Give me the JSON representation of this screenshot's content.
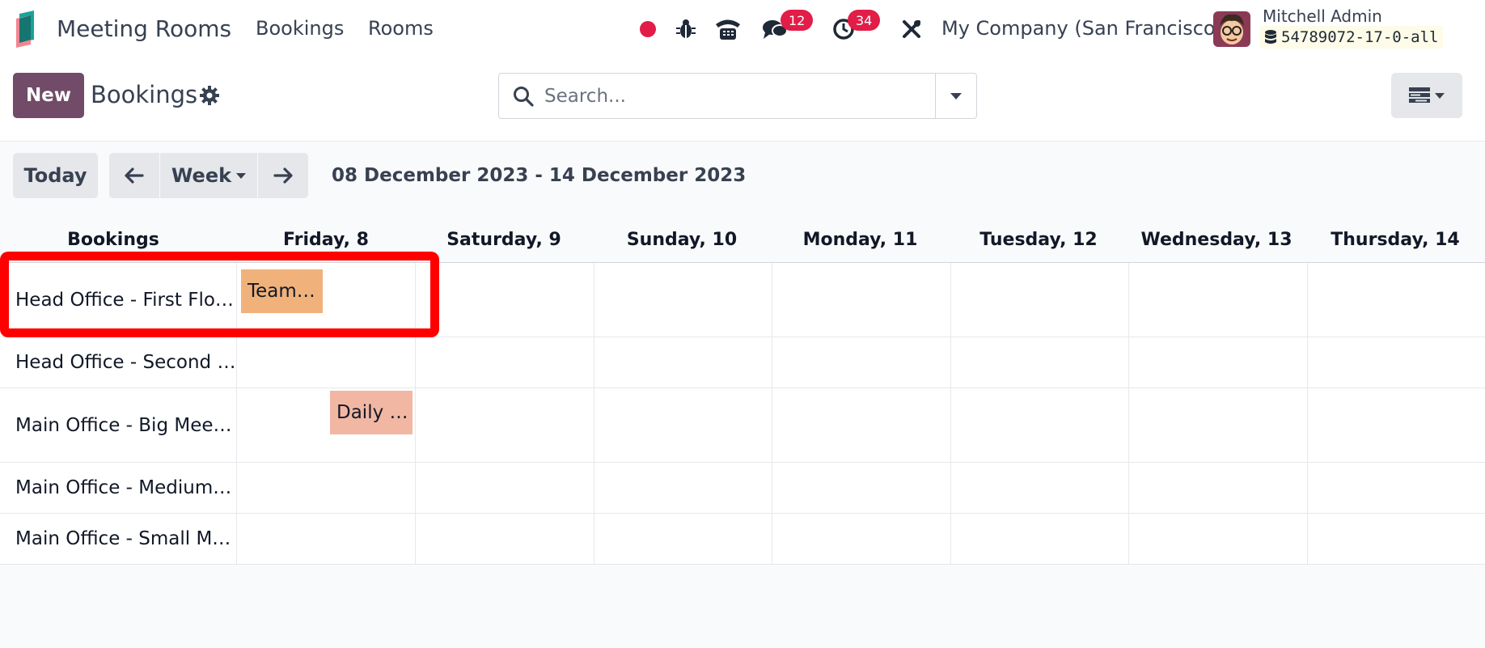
{
  "navbar": {
    "app_name": "Meeting Rooms",
    "menu": [
      "Bookings",
      "Rooms"
    ],
    "messages_count": "12",
    "activities_count": "34",
    "company": "My Company (San Francisco)",
    "user_name": "Mitchell Admin",
    "database": "54789072-17-0-all",
    "colors": {
      "accent": "#714b67",
      "badge": "#e11d48",
      "record": "#e11d48"
    }
  },
  "control_panel": {
    "new_label": "New",
    "title": "Bookings",
    "search_placeholder": "Search..."
  },
  "calendar": {
    "today_label": "Today",
    "scale_label": "Week",
    "date_range": "08 December 2023 - 14 December 2023",
    "header_first": "Bookings",
    "days": [
      "Friday, 8",
      "Saturday, 9",
      "Sunday, 10",
      "Monday, 11",
      "Tuesday, 12",
      "Wednesday, 13",
      "Thursday, 14"
    ],
    "rows": [
      {
        "label": "Head Office - First Flo…"
      },
      {
        "label": "Head Office - Second …"
      },
      {
        "label": "Main Office - Big Mee…"
      },
      {
        "label": "Main Office - Medium…"
      },
      {
        "label": "Main Office - Small M…"
      }
    ],
    "events": [
      {
        "label": "Team…",
        "color": "#f0b27a"
      },
      {
        "label": "Daily …",
        "color": "#f1b7a2"
      }
    ]
  }
}
